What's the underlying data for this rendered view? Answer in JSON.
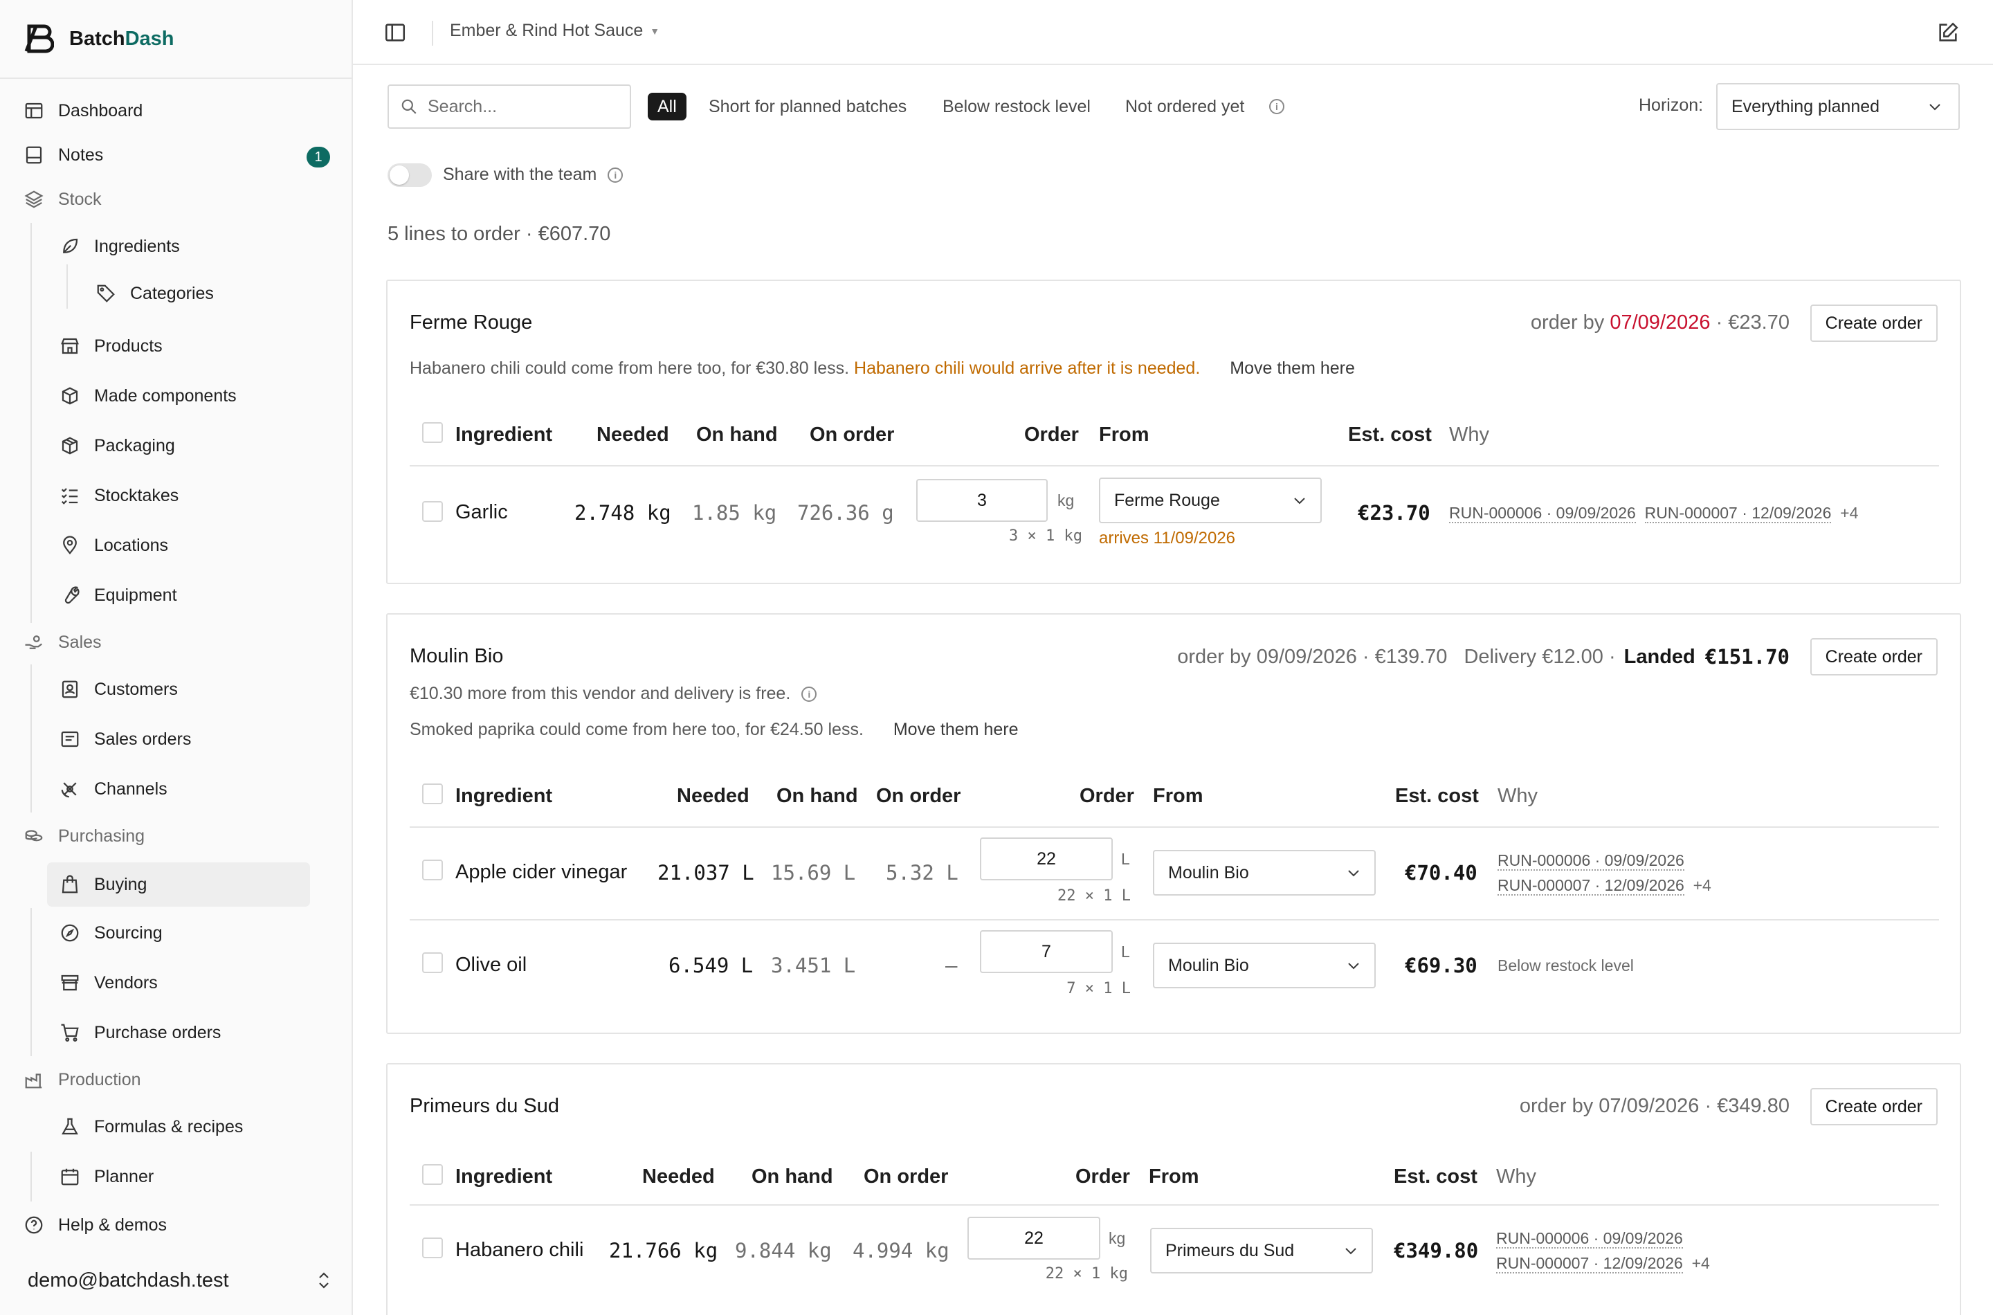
{
  "app": {
    "brand_a": "Batch",
    "brand_b": "Dash"
  },
  "nav": {
    "dashboard": "Dashboard",
    "notes": "Notes",
    "notes_badge": "1",
    "stock": "Stock",
    "ingredients": "Ingredients",
    "categories": "Categories",
    "products": "Products",
    "made_components": "Made components",
    "packaging": "Packaging",
    "stocktakes": "Stocktakes",
    "locations": "Locations",
    "equipment": "Equipment",
    "sales": "Sales",
    "customers": "Customers",
    "sales_orders": "Sales orders",
    "channels": "Channels",
    "purchasing": "Purchasing",
    "buying": "Buying",
    "sourcing": "Sourcing",
    "vendors": "Vendors",
    "purchase_orders": "Purchase orders",
    "production": "Production",
    "formulas": "Formulas & recipes",
    "planner": "Planner",
    "help": "Help & demos",
    "user_email": "demo@batchdash.test"
  },
  "topbar": {
    "workspace": "Ember & Rind Hot Sauce"
  },
  "toolbar": {
    "search_placeholder": "Search...",
    "filter_all": "All",
    "filter_short": "Short for planned batches",
    "filter_below": "Below restock level",
    "filter_not_ordered": "Not ordered yet",
    "horizon_label": "Horizon:",
    "horizon_value": "Everything planned",
    "share_label": "Share with the team"
  },
  "summary": "5 lines to order · €607.70",
  "columns": {
    "ingredient": "Ingredient",
    "needed": "Needed",
    "on_hand": "On hand",
    "on_order": "On order",
    "order": "Order",
    "from": "From",
    "est_cost": "Est. cost",
    "why": "Why"
  },
  "vendors": [
    {
      "name": "Ferme Rouge",
      "order_by_label": "order by",
      "order_by_date": "07/09/2026",
      "order_total": "· €23.70",
      "create_label": "Create order",
      "note_a": "Habanero chili could come from here too, for €30.80 less.",
      "note_warn": "Habanero chili would arrive after it is needed.",
      "move_label": "Move them here",
      "rows": [
        {
          "name": "Garlic",
          "needed_v": "2.748",
          "needed_u": "kg",
          "onhand_v": "1.85",
          "onhand_u": "kg",
          "onorder_v": "726.36",
          "onorder_u": "g",
          "qty": "3",
          "qty_unit": "kg",
          "pack": "3 × 1 kg",
          "from": "Ferme Rouge",
          "arrives": "arrives 11/09/2026",
          "cost": "€23.70",
          "why_a": "RUN-000006 · 09/09/2026",
          "why_b": "RUN-000007 · 12/09/2026",
          "why_more": "+4"
        }
      ]
    },
    {
      "name": "Moulin Bio",
      "order_by_text": "order by 09/09/2026 · €139.70",
      "delivery_text": "Delivery €12.00 ·",
      "landed_label": "Landed",
      "landed_value": "€151.70",
      "create_label": "Create order",
      "note_free": "€10.30 more from this vendor and delivery is free.",
      "note_a": "Smoked paprika could come from here too, for €24.50 less.",
      "move_label": "Move them here",
      "rows": [
        {
          "name": "Apple cider vinegar",
          "needed_v": "21.037",
          "needed_u": "L",
          "onhand_v": "15.69",
          "onhand_u": "L",
          "onorder_v": "5.32",
          "onorder_u": "L",
          "qty": "22",
          "qty_unit": "L",
          "pack": "22 × 1 L",
          "from": "Moulin Bio",
          "cost": "€70.40",
          "why_a": "RUN-000006 · 09/09/2026",
          "why_b": "RUN-000007 · 12/09/2026",
          "why_more": "+4"
        },
        {
          "name": "Olive oil",
          "needed_v": "6.549",
          "needed_u": "L",
          "onhand_v": "3.451",
          "onhand_u": "L",
          "onorder_v": "–",
          "qty": "7",
          "qty_unit": "L",
          "pack": "7 × 1 L",
          "from": "Moulin Bio",
          "cost": "€69.30",
          "why_text": "Below restock level"
        }
      ]
    },
    {
      "name": "Primeurs du Sud",
      "order_by_text": "order by 07/09/2026 · €349.80",
      "create_label": "Create order",
      "rows": [
        {
          "name": "Habanero chili",
          "needed_v": "21.766",
          "needed_u": "kg",
          "onhand_v": "9.844",
          "onhand_u": "kg",
          "onorder_v": "4.994",
          "onorder_u": "kg",
          "qty": "22",
          "qty_unit": "kg",
          "pack": "22 × 1 kg",
          "from": "Primeurs du Sud",
          "cost": "€349.80",
          "why_a": "RUN-000006 · 09/09/2026",
          "why_b": "RUN-000007 · 12/09/2026",
          "why_more": "+4"
        }
      ]
    }
  ],
  "colors": {
    "accent": "#0d6b62",
    "late": "#c8102e",
    "warning": "#c06a00"
  },
  "icons": [
    "dashboard-icon",
    "notes-icon",
    "layers-icon",
    "leaf-icon",
    "tag-icon",
    "store-icon",
    "box-icon",
    "package-icon",
    "checklist-icon",
    "map-pin-icon",
    "wrench-icon",
    "hand-coins-icon",
    "contact-icon",
    "receipt-icon",
    "satellite-icon",
    "coins-icon",
    "shopping-bag-icon",
    "compass-icon",
    "shop-icon",
    "cart-icon",
    "factory-icon",
    "flask-icon",
    "calendar-icon",
    "help-circle-icon",
    "chevrons-up-down-icon",
    "sidebar-toggle-icon",
    "edit-icon",
    "search-icon",
    "chevron-down-icon",
    "info-icon"
  ]
}
